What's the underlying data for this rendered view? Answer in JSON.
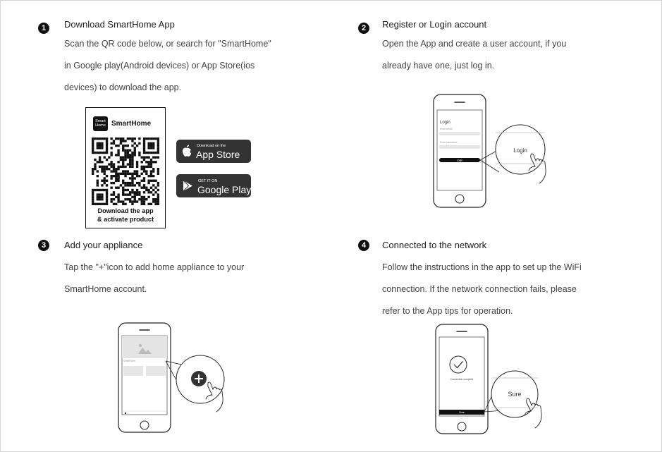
{
  "steps": [
    {
      "number": "1",
      "title": "Download SmartHome App",
      "lines": [
        "Scan the QR code below, or search for \"SmartHome\"",
        "in Google play(Android devices) or App Store(ios",
        "devices) to download the app."
      ]
    },
    {
      "number": "2",
      "title": "Register or Login account",
      "lines": [
        "Open the App and create a user account, if you",
        "already have one, just log in."
      ]
    },
    {
      "number": "3",
      "title": "Add your appliance",
      "lines": [
        "Tap the \"+\"icon to add home appliance to your",
        "SmartHome account."
      ]
    },
    {
      "number": "4",
      "title": "Connected to the network",
      "lines": [
        "Follow the instructions in the app to set up the WiFi",
        "connection. If the network connection fails, please",
        "refer to the App tips for operation."
      ]
    }
  ],
  "qr_card": {
    "logo_line1": "Smart",
    "logo_line2": "Home",
    "brand": "SmartHome",
    "caption_line1": "Download the app",
    "caption_line2": "& activate product"
  },
  "app_store": {
    "small": "Download on the",
    "big": "App Store"
  },
  "google_play": {
    "small": "GET IT ON",
    "big": "Google Play"
  },
  "login_phone": {
    "title": "Login",
    "email_placeholder": "Enter email",
    "password_placeholder": "Enter password",
    "button": "Login",
    "zoom_label": "Login"
  },
  "appliance_phone": {
    "card_label": "SmartHome",
    "zoom_icon": "plus-icon"
  },
  "network_phone": {
    "status": "Connection complete",
    "button": "Sure",
    "zoom_label": "Sure"
  },
  "colors": {
    "text": "#333333",
    "badge": "#333333",
    "outline": "#111111"
  }
}
